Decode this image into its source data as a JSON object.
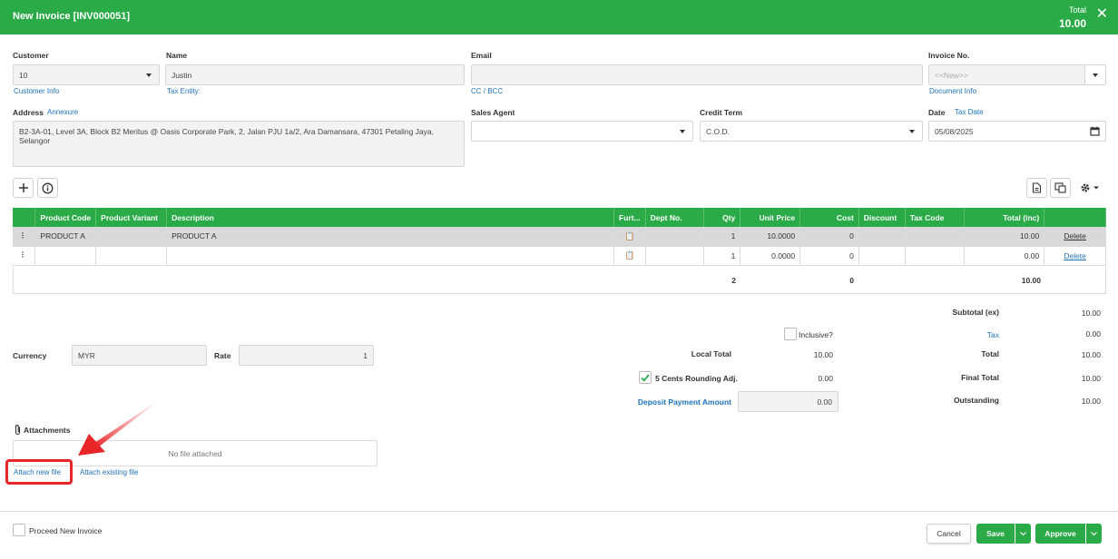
{
  "header": {
    "title": "New Invoice [INV000051]",
    "total_label": "Total",
    "total_value": "10.00",
    "close_icon": "close-icon"
  },
  "customer": {
    "label": "Customer",
    "value": "10",
    "link": "Customer Info"
  },
  "name": {
    "label": "Name",
    "value": "Justin",
    "link": "Tax Entity:"
  },
  "email": {
    "label": "Email",
    "value": "",
    "link": "CC / BCC"
  },
  "invoice_no": {
    "label": "Invoice No.",
    "placeholder": "<<New>>",
    "link": "Document Info"
  },
  "address": {
    "label": "Address",
    "link": "Annexure",
    "value": "B2-3A-01, Level 3A, Block B2 Meritus @ Oasis Corporate Park, 2, Jalan PJU 1a/2, Ara Damansara, 47301 Petaling Jaya, Selangor"
  },
  "sales_agent": {
    "label": "Sales Agent",
    "value": ""
  },
  "credit_term": {
    "label": "Credit Term",
    "value": "C.O.D."
  },
  "date": {
    "label": "Date",
    "link": "Tax Date",
    "value": "05/08/2025"
  },
  "toolbar": {
    "add_icon": "plus-icon",
    "info_icon": "info-icon",
    "doc_icon": "document-icon",
    "copy_icon": "copy-icon",
    "settings_icon": "gear-icon"
  },
  "table": {
    "columns": [
      "Product Code",
      "Product Variant",
      "Description",
      "Furt...",
      "Dept No.",
      "Qty",
      "Unit Price",
      "Cost",
      "Discount",
      "Tax Code",
      "Total (inc)",
      ""
    ],
    "rows": [
      {
        "code": "PRODUCT A",
        "variant": "",
        "description": "PRODUCT A",
        "dept": "",
        "qty": "1",
        "unit_price": "10.0000",
        "cost": "0",
        "discount": "",
        "tax_code": "",
        "total": "10.00",
        "delete": "Delete"
      },
      {
        "code": "",
        "variant": "",
        "description": "",
        "dept": "",
        "qty": "1",
        "unit_price": "0.0000",
        "cost": "0",
        "discount": "",
        "tax_code": "",
        "total": "0.00",
        "delete": "Delete"
      }
    ],
    "footer": {
      "qty": "2",
      "cost": "0",
      "total": "10.00"
    }
  },
  "summary": {
    "subtotal_label": "Subtotal (ex)",
    "subtotal": "10.00",
    "inclusive_label": "Inclusive?",
    "tax_label": "Tax",
    "tax": "0.00",
    "local_total_label": "Local Total",
    "local_total": "10.00",
    "total_label": "Total",
    "total": "10.00",
    "rounding_label": "5 Cents Rounding Adj.",
    "rounding": "0.00",
    "final_total_label": "Final Total",
    "final_total": "10.00",
    "deposit_label": "Deposit Payment Amount",
    "deposit": "0.00",
    "outstanding_label": "Outstanding",
    "outstanding": "10.00"
  },
  "currency": {
    "label": "Currency",
    "value": "MYR",
    "rate_label": "Rate",
    "rate": "1"
  },
  "attachments": {
    "label": "Attachments",
    "empty": "No file attached",
    "attach_new": "Attach new file",
    "attach_existing": "Attach existing file"
  },
  "footer": {
    "proceed_label": "Proceed New Invoice",
    "cancel": "Cancel",
    "save": "Save",
    "approve": "Approve"
  },
  "colors": {
    "brand": "#2bab47",
    "link": "#1e73be",
    "highlight": "#e8262a"
  }
}
